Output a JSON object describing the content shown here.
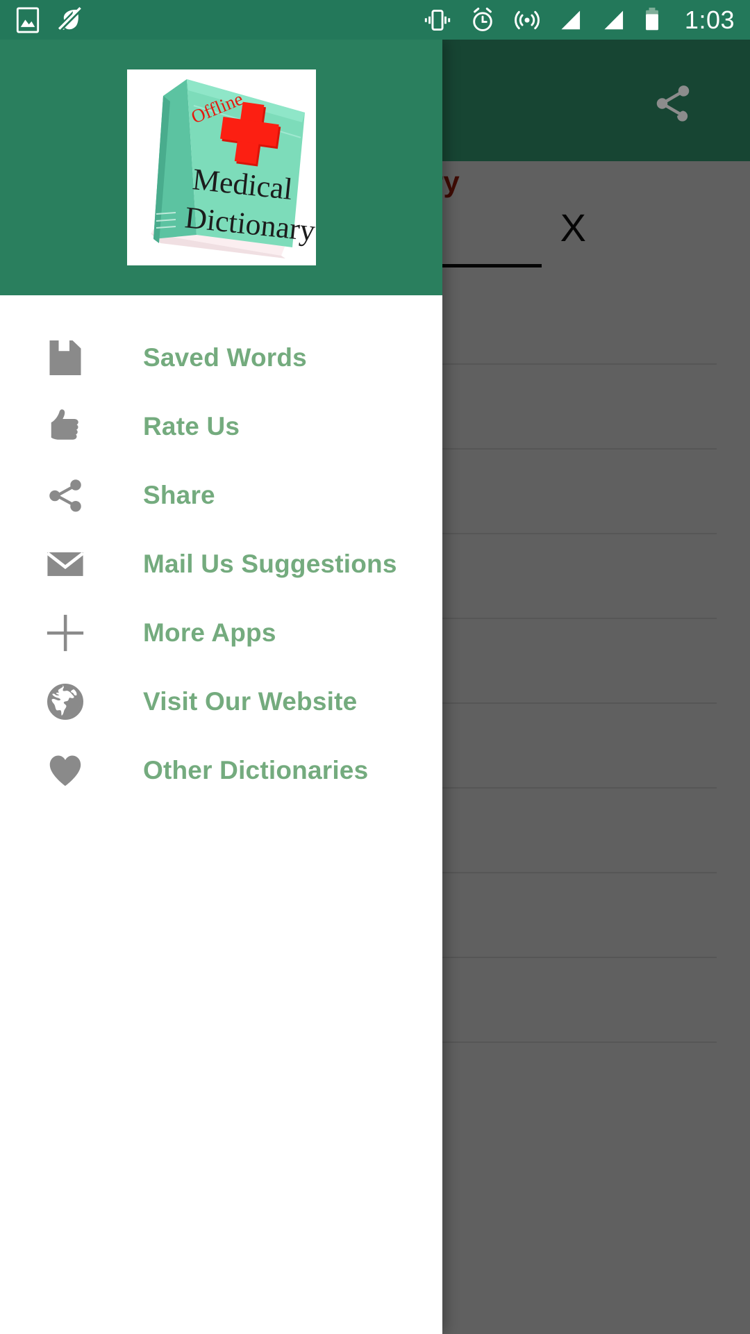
{
  "status_bar": {
    "time": "1:03",
    "left_icons": [
      "screenshot-icon",
      "data-saver-off-icon"
    ],
    "right_icons": [
      "vibrate-icon",
      "alarm-icon",
      "hotspot-icon",
      "signal-sim1-icon",
      "signal-sim2-icon",
      "battery-icon"
    ],
    "background_color": "#23785a",
    "foreground_color": "#ffffff"
  },
  "background_app": {
    "app_bar": {
      "share_icon": "share-icon",
      "background_color": "#2a7f5e"
    },
    "title": "s Dictionary",
    "clear_button": "X",
    "dim_overlay": true
  },
  "drawer": {
    "header": {
      "background_color": "#2a7f5e",
      "logo": {
        "name": "medical-dictionary-book-logo",
        "badge_text": "Offline",
        "title_line1": "Medical",
        "title_line2": "Dictionary",
        "cover_color": "#79d9b8",
        "cross_color": "#f61b10",
        "badge_color": "#e01b10"
      }
    },
    "items": [
      {
        "label": "Saved Words",
        "icon": "save-icon"
      },
      {
        "label": "Rate Us",
        "icon": "thumbs-up-icon"
      },
      {
        "label": "Share",
        "icon": "share-icon"
      },
      {
        "label": "Mail Us Suggestions",
        "icon": "mail-icon"
      },
      {
        "label": "More Apps",
        "icon": "plus-icon"
      },
      {
        "label": "Visit Our Website",
        "icon": "globe-icon"
      },
      {
        "label": "Other Dictionaries",
        "icon": "heart-icon"
      }
    ],
    "label_color": "#74ab7e",
    "icon_color": "#8a8a8a",
    "background_color": "#ffffff"
  }
}
